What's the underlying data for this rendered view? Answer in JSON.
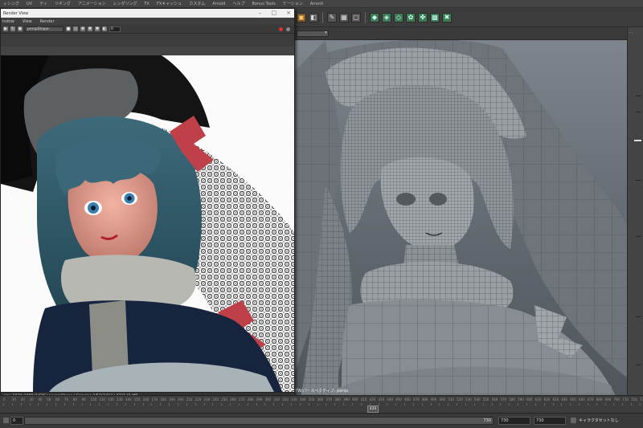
{
  "main_menu": {
    "items": [
      "ィシング",
      "UV",
      "ティ",
      "リギング",
      "アニメーション",
      "レンダリング",
      "FX",
      "FXキャッシュ",
      "カスタム",
      "Arnold",
      "ヘルプ",
      "Bonus Tools",
      "ケーション",
      "Arnold"
    ]
  },
  "render_view": {
    "title": "Render View",
    "menu": [
      "indow",
      "View",
      "Render"
    ],
    "camera": "perspShape",
    "exposure": "0",
    "status": "size: 1920x1080 (142%) | perspShape | Samples 3/5/2/2/2/3 | 4722.41 MB"
  },
  "viewport": {
    "label": "TW/パースペクティブ: persp"
  },
  "time_slider": {
    "labels": [
      "0",
      "10",
      "20",
      "30",
      "40",
      "50",
      "60",
      "70",
      "80",
      "90",
      "100",
      "110",
      "120",
      "130",
      "140",
      "150",
      "160",
      "170",
      "180",
      "190",
      "200",
      "210",
      "220",
      "230",
      "240",
      "250",
      "260",
      "270",
      "280",
      "290",
      "300",
      "310",
      "320",
      "330",
      "340",
      "350",
      "360",
      "370",
      "380",
      "390",
      "400",
      "410",
      "420",
      "430",
      "440",
      "450",
      "460",
      "470",
      "480",
      "490",
      "500",
      "510",
      "520",
      "530",
      "540",
      "550",
      "560",
      "570",
      "580",
      "590",
      "600",
      "610",
      "620",
      "630",
      "640",
      "650",
      "660",
      "670",
      "680",
      "690",
      "700",
      "710",
      "720",
      "730"
    ],
    "current_frame": "420"
  },
  "range_slider": {
    "start": "0",
    "end_marker": "730",
    "end1": "730",
    "end2": "730",
    "character_set": "キャラクタセットなし"
  },
  "colors": {
    "accent": "#3d7a55",
    "viewport_bg": "#7e858d",
    "panel_bg": "#444444"
  }
}
